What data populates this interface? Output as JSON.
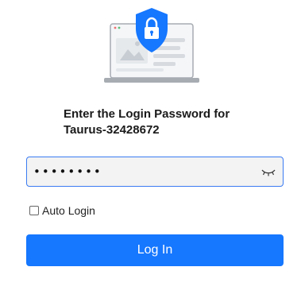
{
  "heading": {
    "line1": "Enter the Login Password for",
    "line2": "Taurus-32428672"
  },
  "password": {
    "value": "••••••••",
    "toggle_icon": "eye-closed-icon"
  },
  "auto_login": {
    "label": "Auto Login",
    "checked": false
  },
  "login_button": {
    "label": "Log In"
  },
  "illustration": {
    "icons": [
      "laptop-icon",
      "shield-lock-icon"
    ]
  },
  "colors": {
    "accent": "#1677ff",
    "input_border": "#3a7bf2",
    "input_bg": "#f3f3f3"
  }
}
